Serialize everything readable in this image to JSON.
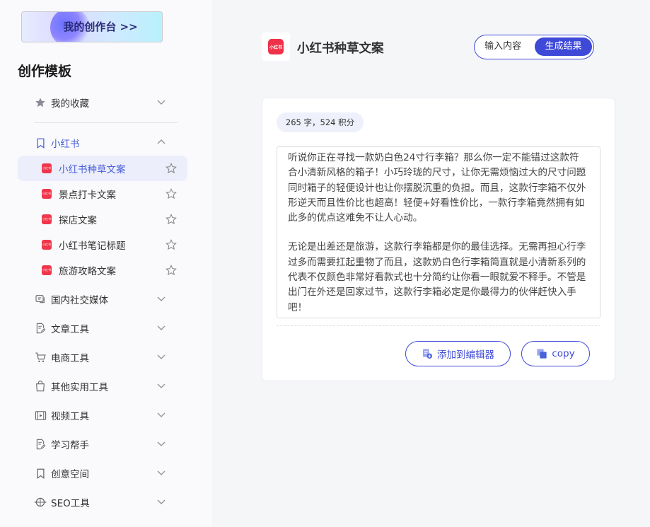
{
  "sidebar": {
    "studio_button": "我的创作台 >>",
    "section_title": "创作模板",
    "favorites": "我的收藏",
    "group_xhs": "小红书",
    "xhs_items": [
      {
        "label": "小红书种草文案",
        "selected": true
      },
      {
        "label": "景点打卡文案",
        "selected": false
      },
      {
        "label": "探店文案",
        "selected": false
      },
      {
        "label": "小红书笔记标题",
        "selected": false
      },
      {
        "label": "旅游攻略文案",
        "selected": false
      }
    ],
    "groups": [
      {
        "label": "国内社交媒体",
        "icon": "chat-icon"
      },
      {
        "label": "文章工具",
        "icon": "document-edit-icon"
      },
      {
        "label": "电商工具",
        "icon": "cart-icon"
      },
      {
        "label": "其他实用工具",
        "icon": "bag-icon"
      },
      {
        "label": "视频工具",
        "icon": "film-icon"
      },
      {
        "label": "学习帮手",
        "icon": "notes-icon"
      },
      {
        "label": "创意空间",
        "icon": "bookmark-icon"
      },
      {
        "label": "SEO工具",
        "icon": "seo-icon"
      }
    ]
  },
  "header": {
    "logo_text": "小红书",
    "title": "小红书种草文案",
    "toggle_input": "输入内容",
    "toggle_result": "生成结果"
  },
  "result": {
    "count": "265 字，524 积分",
    "paragraph1": "听说你正在寻找一款奶白色24寸行李箱？那么你一定不能错过这款符合小清新风格的箱子！小巧玲珑的尺寸，让你无需烦恼过大的尺寸问题同时箱子的轻便设计也让你摆脱沉重的负担。而且，这款行李箱不仅外形逆天而且性价比也超高！轻便+好看性价比，一款行李箱竟然拥有如此多的优点这难免不让人心动。",
    "paragraph2": "无论是出差还是旅游，这款行李箱都是你的最佳选择。无需再担心行李过多而需要扛起重物了而且，这款奶白色行李箱简直就是小清新系列的代表不仅颜色非常好看款式也十分简约让你看一眼就爱不释手。不管是出门在外还是回家过节，这款行李箱必定是你最得力的伙伴赶快入手吧！",
    "add_to_editor": "添加到编辑器",
    "copy": "copy"
  },
  "colors": {
    "accent": "#3e49d8",
    "xhs_red": "#ef3249",
    "selected_bg": "#eceefc"
  }
}
